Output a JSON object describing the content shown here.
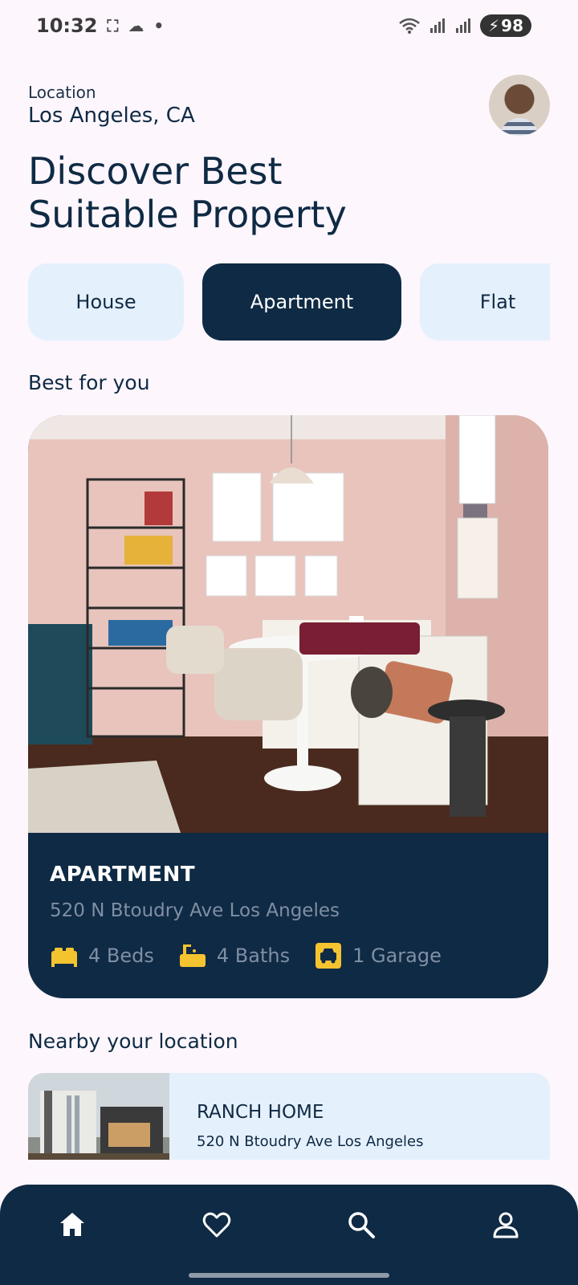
{
  "status_bar": {
    "time": "10:32",
    "battery": "98"
  },
  "header": {
    "location_label": "Location",
    "location_value": "Los Angeles, CA",
    "headline_line1": "Discover Best",
    "headline_line2": "Suitable Property"
  },
  "categories": [
    {
      "label": "House",
      "active": false
    },
    {
      "label": "Apartment",
      "active": true
    },
    {
      "label": "Flat",
      "active": false
    }
  ],
  "best_for_you": {
    "section_title": "Best for you",
    "type": "APARTMENT",
    "address": "520 N Btoudry Ave Los Angeles",
    "beds": "4 Beds",
    "baths": "4 Baths",
    "garage": "1 Garage"
  },
  "nearby": {
    "section_title": "Nearby your location",
    "items": [
      {
        "title": "RANCH HOME",
        "address": "520 N Btoudry Ave Los Angeles"
      }
    ]
  },
  "bottom_nav": {
    "items": [
      {
        "icon": "home-icon"
      },
      {
        "icon": "heart-icon"
      },
      {
        "icon": "search-icon"
      },
      {
        "icon": "profile-icon"
      }
    ]
  },
  "colors": {
    "primary": "#0f2a44",
    "chip_bg": "#e5f0fd",
    "accent": "#f4c430",
    "background": "#fdf6fc"
  }
}
